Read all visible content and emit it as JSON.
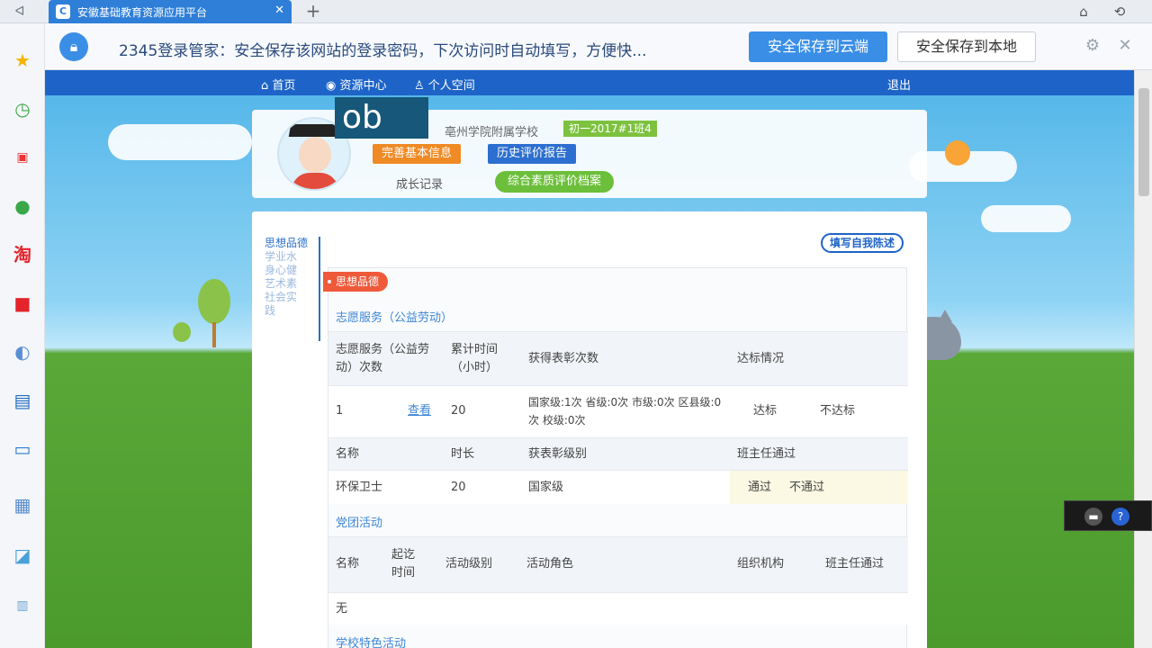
{
  "browser": {
    "tab_title": "安徽基础教育资源应用平台",
    "tab_favicon": "C",
    "new_tab": "+",
    "back_symbol": "ᐊ",
    "restore_icon": "⌂",
    "undo_icon": "⟲"
  },
  "password_bar": {
    "message": "2345登录管家：安全保存该网站的登录密码，下次访问时自动填写，方便快...",
    "save_cloud": "安全保存到云端",
    "save_local": "安全保存到本地"
  },
  "navbar": {
    "home": "首页",
    "resources": "资源中心",
    "personal": "个人空间",
    "logout": "退出"
  },
  "profile": {
    "school": "亳州学院附属学校",
    "grade_tag": "初一2017#1班4",
    "complete_info": "完善基本信息",
    "history_report": "历史评价报告",
    "growth_record": "成长记录",
    "archive": "综合素质评价档案",
    "overlay_text": "ob"
  },
  "leftnav": {
    "items": [
      "思想品德",
      "学业水",
      "身心健",
      "艺术素",
      "社会实",
      "践"
    ]
  },
  "main": {
    "self_eval_button": "填写自我陈述",
    "section_tag": "思想品德",
    "volunteer": {
      "title": "志愿服务（公益劳动）",
      "headers": [
        "志愿服务（公益劳动）次数",
        "累计时间（小时）",
        "获得表彰次数",
        "达标情况"
      ],
      "count": "1",
      "view_link": "查看",
      "hours": "20",
      "awards": "国家级:1次 省级:0次 市级:0次 区县级:0次 校级:0次",
      "pass": "达标",
      "fail": "不达标",
      "detail_headers": [
        "名称",
        "时长",
        "获表彰级别",
        "班主任通过"
      ],
      "detail_name": "环保卫士",
      "detail_hours": "20",
      "detail_level": "国家级",
      "approve": "通过",
      "reject": "不通过"
    },
    "league": {
      "title": "党团活动",
      "headers": [
        "名称",
        "起讫时间",
        "活动级别",
        "活动角色",
        "组织机构",
        "班主任通过"
      ],
      "empty": "无"
    },
    "school_activity": {
      "title": "学校特色活动"
    }
  },
  "colors": {
    "brand_blue": "#1e64c8",
    "accent_orange": "#ef5a3a",
    "green": "#6cbf3a"
  }
}
